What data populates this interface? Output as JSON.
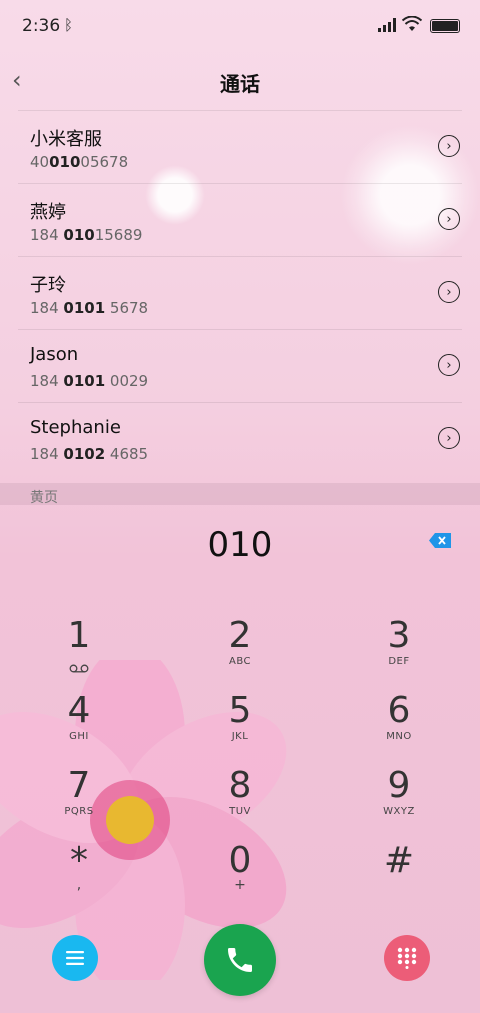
{
  "status_bar": {
    "time": "2:36",
    "icons": [
      "bluetooth-icon",
      "signal-icon",
      "wifi-icon",
      "battery-icon"
    ]
  },
  "header": {
    "title": "通话",
    "back_icon": "chevron-left-icon"
  },
  "contacts": [
    {
      "name": "小米客服",
      "number_prefix": "40",
      "number_match": "010",
      "number_suffix": "05678"
    },
    {
      "name": "燕婷",
      "number_prefix": "184 ",
      "number_match": "010",
      "number_suffix": "15689"
    },
    {
      "name": "子玲",
      "number_prefix": "184 ",
      "number_match": "0101",
      "number_suffix": " 5678"
    },
    {
      "name": "Jason",
      "number_prefix": "184 ",
      "number_match": "0101",
      "number_suffix": " 0029"
    },
    {
      "name": "Stephanie",
      "number_prefix": "184 ",
      "number_match": "0102",
      "number_suffix": " 4685"
    }
  ],
  "section_label": "黄页",
  "dialer": {
    "display": "010",
    "delete_icon": "backspace-icon"
  },
  "keypad": [
    {
      "digit": "1",
      "letters": "",
      "sub": "voicemail-icon"
    },
    {
      "digit": "2",
      "letters": "ABC"
    },
    {
      "digit": "3",
      "letters": "DEF"
    },
    {
      "digit": "4",
      "letters": "GHI"
    },
    {
      "digit": "5",
      "letters": "JKL"
    },
    {
      "digit": "6",
      "letters": "MNO"
    },
    {
      "digit": "7",
      "letters": "PQRS"
    },
    {
      "digit": "8",
      "letters": "TUV"
    },
    {
      "digit": "9",
      "letters": "WXYZ"
    },
    {
      "digit": "*",
      "letters": ","
    },
    {
      "digit": "0",
      "letters": "+"
    },
    {
      "digit": "#",
      "letters": ""
    }
  ],
  "bottom_bar": {
    "menu_icon": "menu-icon",
    "call_icon": "phone-icon",
    "keypad_icon": "dialpad-icon"
  },
  "colors": {
    "menu_button": "#19b8f0",
    "call_button": "#1aa44f",
    "keypad_button": "#ec5d78",
    "delete_key": "#1f95e8"
  }
}
